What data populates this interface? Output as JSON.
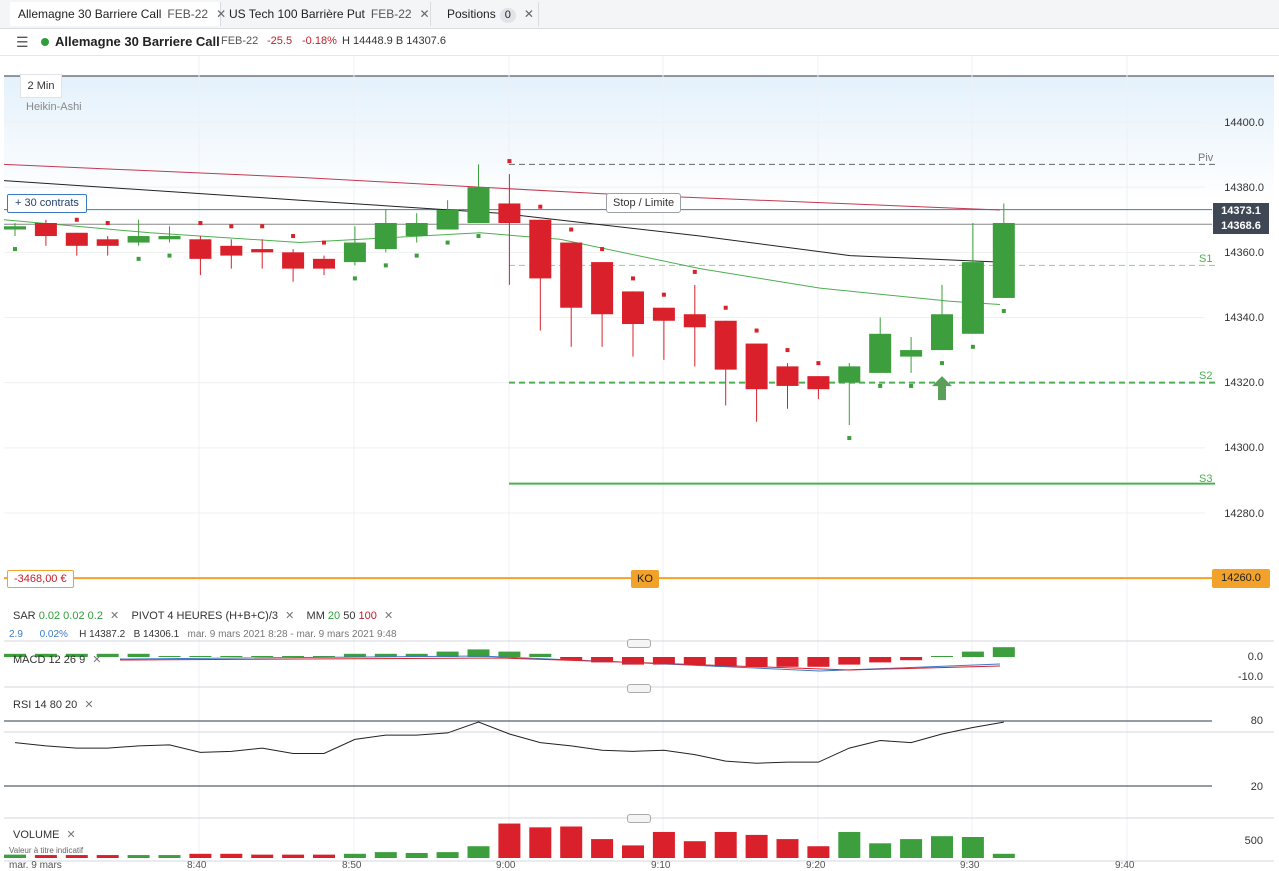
{
  "tabs": [
    {
      "title": "Allemagne 30 Barriere Call",
      "sub": "FEB-22",
      "close": "✕",
      "active": true
    },
    {
      "title": "US Tech 100 Barrière Put",
      "sub": "FEB-22",
      "close": "✕",
      "active": false
    },
    {
      "title": "Positions",
      "badge": "0",
      "close": "✕",
      "active": false
    }
  ],
  "header": {
    "menu_icon": "hamburger-icon",
    "instrument": "Allemagne 30 Barriere Call",
    "expiry": "FEB-22",
    "change": "-25.5",
    "change_pct": "-0.18%",
    "high_low": "H 14448.9 B 14307.6",
    "status_color": "#2e9d3a"
  },
  "chart": {
    "timeframe": "2 Min",
    "style": "Heikin-Ashi",
    "price_axis": [
      "14400.0",
      "14380.0",
      "14360.0",
      "14340.0",
      "14320.0",
      "14300.0",
      "14280.0"
    ],
    "current_price_top": "14373.1",
    "current_price_bottom": "14368.6",
    "pivot_labels": {
      "piv": "Piv",
      "s1": "S1",
      "s2": "S2",
      "s3": "S3"
    },
    "contracts_label": "+ 30 contrats",
    "stop_limit_label": "Stop / Limite",
    "pnl_label": "-3468,00 €",
    "ko_label": "KO",
    "ko_level": "14260.0",
    "colors": {
      "up": "#3c9e3c",
      "down": "#d9202b",
      "ko": "#f2a12b",
      "ma_red": "#c4384f",
      "ma_black": "#222222",
      "ma_green": "#4caf50"
    }
  },
  "chart_data": {
    "type": "candlestick",
    "style": "Heikin-Ashi",
    "timeframe_minutes": 2,
    "ylim": [
      14250,
      14420
    ],
    "pivots": {
      "Piv": 14387,
      "S1": 14356,
      "S2": 14320,
      "S3": 14289
    },
    "ko_level": 14260,
    "bid": 14368.6,
    "ask": 14373.1,
    "x_ticks": [
      "mar. 9 mars",
      "8:40",
      "8:50",
      "9:00",
      "9:10",
      "9:20",
      "9:30",
      "9:40"
    ],
    "candles": [
      {
        "o": 14367,
        "h": 14369,
        "l": 14365,
        "c": 14368
      },
      {
        "o": 14369,
        "h": 14370,
        "l": 14362,
        "c": 14365
      },
      {
        "o": 14366,
        "h": 14366,
        "l": 14359,
        "c": 14362
      },
      {
        "o": 14364,
        "h": 14365,
        "l": 14359,
        "c": 14362
      },
      {
        "o": 14363,
        "h": 14370,
        "l": 14362,
        "c": 14365
      },
      {
        "o": 14364,
        "h": 14368,
        "l": 14363,
        "c": 14365
      },
      {
        "o": 14364,
        "h": 14365,
        "l": 14353,
        "c": 14358
      },
      {
        "o": 14362,
        "h": 14364,
        "l": 14355,
        "c": 14359
      },
      {
        "o": 14361,
        "h": 14364,
        "l": 14355,
        "c": 14360
      },
      {
        "o": 14360,
        "h": 14361,
        "l": 14351,
        "c": 14355
      },
      {
        "o": 14358,
        "h": 14359,
        "l": 14353,
        "c": 14355
      },
      {
        "o": 14357,
        "h": 14368,
        "l": 14356,
        "c": 14363
      },
      {
        "o": 14361,
        "h": 14373,
        "l": 14360,
        "c": 14369
      },
      {
        "o": 14365,
        "h": 14372,
        "l": 14363,
        "c": 14369
      },
      {
        "o": 14367,
        "h": 14376,
        "l": 14367,
        "c": 14373
      },
      {
        "o": 14369,
        "h": 14387,
        "l": 14369,
        "c": 14380
      },
      {
        "o": 14375,
        "h": 14384,
        "l": 14350,
        "c": 14369
      },
      {
        "o": 14370,
        "h": 14370,
        "l": 14336,
        "c": 14352
      },
      {
        "o": 14363,
        "h": 14363,
        "l": 14331,
        "c": 14343
      },
      {
        "o": 14357,
        "h": 14357,
        "l": 14331,
        "c": 14341
      },
      {
        "o": 14348,
        "h": 14348,
        "l": 14328,
        "c": 14338
      },
      {
        "o": 14343,
        "h": 14343,
        "l": 14327,
        "c": 14339
      },
      {
        "o": 14341,
        "h": 14350,
        "l": 14325,
        "c": 14337
      },
      {
        "o": 14339,
        "h": 14339,
        "l": 14313,
        "c": 14324
      },
      {
        "o": 14332,
        "h": 14332,
        "l": 14308,
        "c": 14318
      },
      {
        "o": 14325,
        "h": 14326,
        "l": 14312,
        "c": 14319
      },
      {
        "o": 14322,
        "h": 14322,
        "l": 14315,
        "c": 14318
      },
      {
        "o": 14320,
        "h": 14326,
        "l": 14307,
        "c": 14325
      },
      {
        "o": 14323,
        "h": 14340,
        "l": 14323,
        "c": 14335
      },
      {
        "o": 14328,
        "h": 14334,
        "l": 14323,
        "c": 14330
      },
      {
        "o": 14330,
        "h": 14350,
        "l": 14330,
        "c": 14341
      },
      {
        "o": 14335,
        "h": 14369,
        "l": 14335,
        "c": 14357
      },
      {
        "o": 14346,
        "h": 14375,
        "l": 14346,
        "c": 14369
      }
    ],
    "volume": [
      8,
      7,
      7,
      7,
      7,
      7,
      10,
      10,
      8,
      8,
      8,
      10,
      14,
      12,
      14,
      28,
      82,
      73,
      75,
      45,
      30,
      62,
      40,
      62,
      55,
      45,
      28,
      62,
      35,
      45,
      52,
      50,
      10
    ],
    "rsi": [
      60,
      57,
      55,
      55,
      57,
      58,
      51,
      52,
      55,
      50,
      50,
      63,
      67,
      67,
      69,
      79,
      68,
      60,
      57,
      53,
      52,
      53,
      49,
      43,
      41,
      42,
      42,
      55,
      62,
      60,
      68,
      74,
      79
    ],
    "macd_hist": [
      1,
      1,
      1,
      1,
      1,
      0,
      0,
      0,
      0,
      0,
      0,
      1,
      1,
      1,
      2,
      3,
      2,
      1,
      -1,
      -2,
      -3,
      -3,
      -3,
      -4,
      -4,
      -4,
      -4,
      -3,
      -2,
      -1,
      0,
      2,
      4
    ]
  },
  "indicators": {
    "sar": {
      "name": "SAR",
      "p1": "0.02",
      "p2": "0.02",
      "p3": "0.2",
      "close": "✕"
    },
    "pivot": {
      "name": "PIVOT",
      "p1": "4 HEURES",
      "p2": "(H+B+C)/3",
      "close": "✕"
    },
    "mm": {
      "name": "MM",
      "p1": "20",
      "p2": "50",
      "p3": "100",
      "close": "✕"
    },
    "info_line": {
      "v1": "2.9",
      "v2": "0.02%",
      "high": "H 14387.2",
      "low": "B 14306.1",
      "range": "mar. 9 mars 2021 8:28 - mar. 9 mars 2021 9:48"
    },
    "macd": {
      "name": "MACD",
      "p1": "12",
      "p2": "26",
      "p3": "9",
      "close": "✕",
      "axis": [
        "0.0",
        "-10.0"
      ]
    },
    "rsi": {
      "name": "RSI",
      "p1": "14",
      "p2": "80",
      "p3": "20",
      "close": "✕",
      "axis": [
        "80",
        "20"
      ]
    },
    "volume": {
      "name": "VOLUME",
      "close": "✕",
      "note": "Valeur à titre indicatif",
      "axis": [
        "500"
      ]
    }
  },
  "time_axis": [
    "mar. 9 mars",
    "8:40",
    "8:50",
    "9:00",
    "9:10",
    "9:20",
    "9:30",
    "9:40"
  ]
}
